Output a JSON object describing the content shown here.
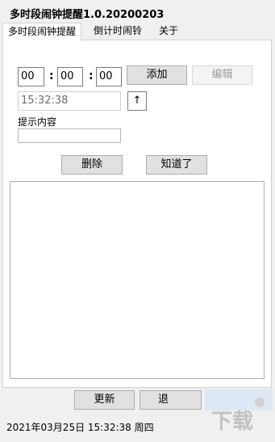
{
  "app": {
    "title": "多时段闹钟提醒1.0.20200203"
  },
  "tabs": [
    "多时段闹钟提醒",
    "倒计时闹铃",
    "关于"
  ],
  "time": {
    "hour": "00",
    "minute": "00",
    "second": "00",
    "colon": ":"
  },
  "buttons": {
    "add": "添加",
    "edit": "编辑",
    "up": "↑",
    "delete": "删除",
    "acknowledge": "知道了",
    "update": "更新",
    "exit_partial": "退"
  },
  "current_time_field": "15:32:38",
  "reminder": {
    "label": "提示内容",
    "value": ""
  },
  "status_bar": "2021年03月25日 15:32:38 周四",
  "watermark": {
    "text": "下载吧",
    "color": "#c9c9c9"
  }
}
